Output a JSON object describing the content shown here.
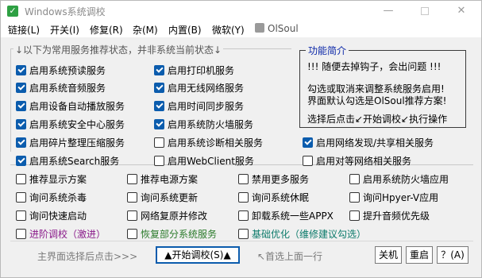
{
  "window": {
    "title": "Windows系统调校"
  },
  "menu": [
    {
      "id": "link",
      "label": "链接(L)"
    },
    {
      "id": "toggle",
      "label": "开关(I)"
    },
    {
      "id": "repair",
      "label": "修复(R)"
    },
    {
      "id": "misc",
      "label": "杂(M)"
    },
    {
      "id": "builtin",
      "label": "内置(B)"
    },
    {
      "id": "micro",
      "label": "微软(Y)"
    },
    {
      "id": "olsoul",
      "label": "OlSoul"
    }
  ],
  "group": {
    "legend": "↓以下为常用服务推荐状态，并非系统当前状态↓"
  },
  "info": {
    "legend": "功能简介",
    "lines": [
      "!!! 随便去掉钩子，会出问题 !!!",
      "勾选或取消来调整系统服务启用!",
      "界面默认勾选是OlSoul推荐方案!",
      "选择后点击↙开始调校↙执行操作"
    ]
  },
  "services": [
    {
      "label": "启用系统预读服务",
      "checked": true
    },
    {
      "label": "启用打印机服务",
      "checked": true
    },
    {
      "label": "启用系统音频服务",
      "checked": true
    },
    {
      "label": "启用无线网络服务",
      "checked": true
    },
    {
      "label": "启用设备自动播放服务",
      "checked": true
    },
    {
      "label": "启用时间同步服务",
      "checked": true
    },
    {
      "label": "启用系统安全中心服务",
      "checked": true
    },
    {
      "label": "启用系统防火墙服务",
      "checked": true
    },
    {
      "label": "启用碎片整理压缩服务",
      "checked": true
    },
    {
      "label": "启用系统诊断相关服务",
      "checked": false
    },
    {
      "label": "启用网络发现/共享相关服务",
      "checked": true
    },
    {
      "label": "启用系统Search服务",
      "checked": true
    },
    {
      "label": "启用WebClient服务",
      "checked": false
    },
    {
      "label": "启用对等网络相关服务",
      "checked": false
    }
  ],
  "options": [
    {
      "label": "推荐显示方案",
      "checked": false
    },
    {
      "label": "推荐电源方案",
      "checked": false
    },
    {
      "label": "禁用更多服务",
      "checked": false
    },
    {
      "label": "启用系统防火墙应用",
      "checked": false
    },
    {
      "label": "询问系统杀毒",
      "checked": false
    },
    {
      "label": "询问系统更新",
      "checked": false
    },
    {
      "label": "询问系统休眠",
      "checked": false
    },
    {
      "label": "询问Hpyer-V应用",
      "checked": false
    },
    {
      "label": "询问快速启动",
      "checked": false
    },
    {
      "label": "网络复原并修改",
      "checked": false
    },
    {
      "label": "卸载系统一些APPX",
      "checked": false
    },
    {
      "label": "提升音频优先级",
      "checked": false
    }
  ],
  "presets": [
    {
      "label": "进阶调校（激进）",
      "checked": false
    },
    {
      "label": "恢复部分系统服务",
      "checked": false
    },
    {
      "label": "基础优化（维修建议勾选）",
      "checked": false
    }
  ],
  "footer": {
    "hint_left": "主界面选择后点击>>>",
    "start_button": "▲开始调校(S)▲",
    "hint_right": "↖首选上面一行",
    "shutdown_button": "关机",
    "restart_button": "重启",
    "help_button": "？(A)"
  },
  "colors": {
    "accent": "#0b5cad",
    "info_title": "#0b27a8",
    "preset_1": "#8a1a8a",
    "preset_2": "#2a7a2a",
    "preset_3": "#0b7a6a"
  }
}
